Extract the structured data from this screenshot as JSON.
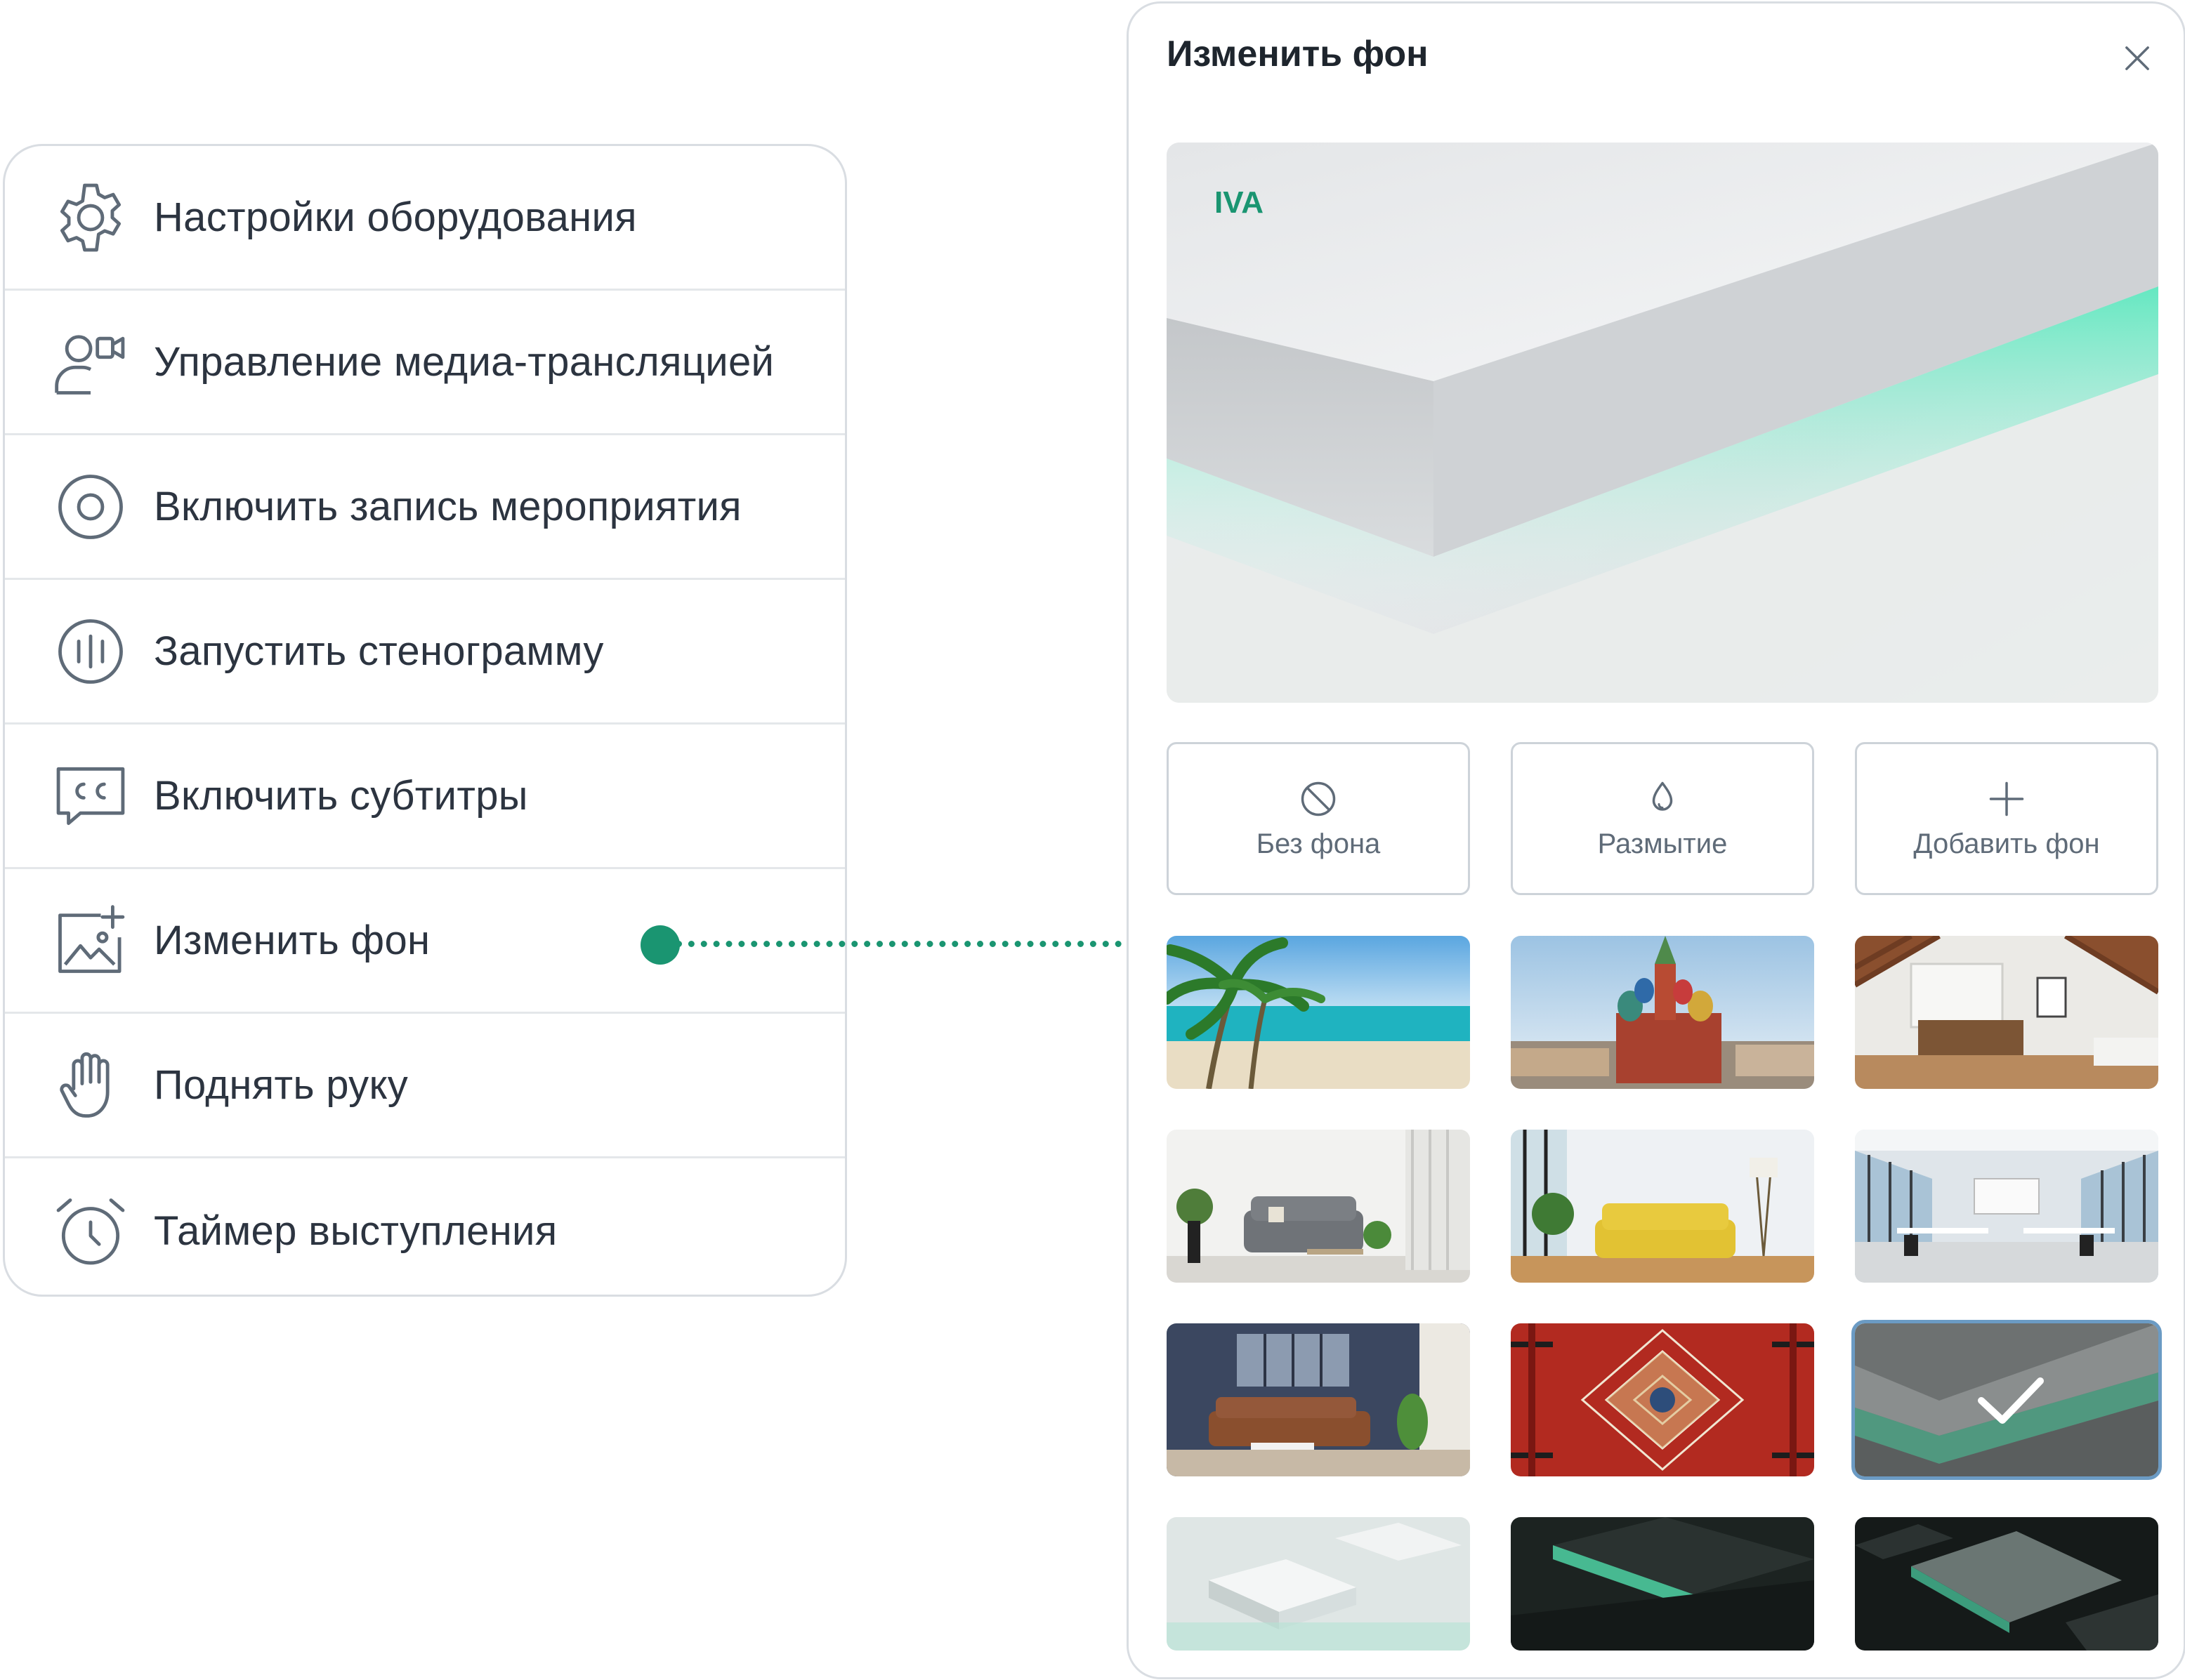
{
  "menu": {
    "items": [
      {
        "label": "Настройки оборудования",
        "icon": "gear-icon"
      },
      {
        "label": "Управление медиа-трансляцией",
        "icon": "media-broadcast-icon"
      },
      {
        "label": "Включить запись мероприятия",
        "icon": "record-icon"
      },
      {
        "label": "Запустить стенограмму",
        "icon": "transcript-icon"
      },
      {
        "label": "Включить субтитры",
        "icon": "subtitles-icon"
      },
      {
        "label": "Изменить фон",
        "icon": "change-background-icon"
      },
      {
        "label": "Поднять руку",
        "icon": "raise-hand-icon"
      },
      {
        "label": "Таймер выступления",
        "icon": "alarm-clock-icon"
      }
    ]
  },
  "panel": {
    "title": "Изменить фон",
    "preview_logo": "IVA",
    "options": [
      {
        "label": "Без фона",
        "icon": "no-background-icon"
      },
      {
        "label": "Размытие",
        "icon": "blur-drop-icon"
      },
      {
        "label": "Добавить фон",
        "icon": "plus-icon"
      }
    ],
    "thumbnails": [
      {
        "subject": "palm beach",
        "selected": false
      },
      {
        "subject": "saint basil's cathedral",
        "selected": false
      },
      {
        "subject": "attic interior",
        "selected": false
      },
      {
        "subject": "living room grey sofa",
        "selected": false
      },
      {
        "subject": "yellow sofa room",
        "selected": false
      },
      {
        "subject": "open office",
        "selected": false
      },
      {
        "subject": "dark living room",
        "selected": false
      },
      {
        "subject": "red carpet pattern",
        "selected": false
      },
      {
        "subject": "iva green glow",
        "selected": true
      },
      {
        "subject": "white blocks",
        "selected": false
      },
      {
        "subject": "dark iva green",
        "selected": false
      },
      {
        "subject": "dark plates",
        "selected": false
      }
    ]
  },
  "colors": {
    "accent": "#1a9571",
    "text": "#2c3440",
    "border": "#d9dde2",
    "selected_border": "#6b9bc4"
  }
}
